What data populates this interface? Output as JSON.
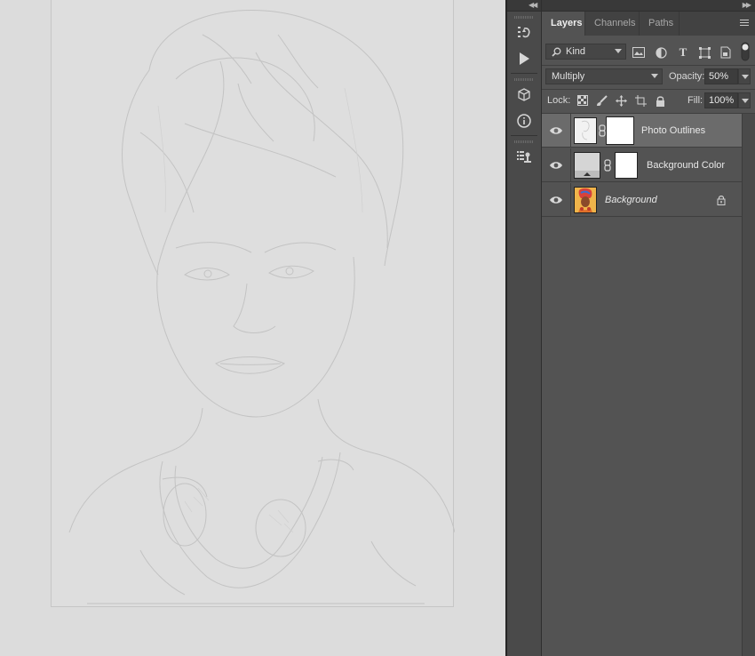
{
  "panel": {
    "tabs": [
      {
        "label": "Layers",
        "active": true
      },
      {
        "label": "Channels",
        "active": false
      },
      {
        "label": "Paths",
        "active": false
      }
    ],
    "filter": {
      "label": "Kind"
    },
    "blend_mode": "Multiply",
    "opacity": {
      "label": "Opacity:",
      "value": "50%"
    },
    "lock": {
      "label": "Lock:"
    },
    "fill": {
      "label": "Fill:",
      "value": "100%"
    },
    "layers": [
      {
        "name": "Photo Outlines",
        "visible": true,
        "selected": true,
        "has_mask": true
      },
      {
        "name": "Background Color",
        "visible": true,
        "selected": false,
        "has_mask": true
      },
      {
        "name": "Background",
        "visible": true,
        "selected": false,
        "locked": true
      }
    ]
  },
  "tool_strip": {
    "icons": [
      "history-icon",
      "actions-play-icon",
      "3d-cube-icon",
      "info-icon",
      "tool-presets-icon"
    ]
  },
  "filter_icons": [
    "image-filter-icon",
    "adjustment-filter-icon",
    "type-filter-icon",
    "shape-filter-icon",
    "smart-object-filter-icon",
    "filter-toggle-icon"
  ],
  "lock_icons": [
    "lock-transparent-pixels-icon",
    "lock-image-pixels-icon",
    "lock-position-icon",
    "lock-artboard-icon",
    "lock-all-icon"
  ],
  "colors": {
    "canvas_bg": "#dcdcdc",
    "panel_bg": "#535353",
    "selected_row": "#6b6b6b"
  }
}
